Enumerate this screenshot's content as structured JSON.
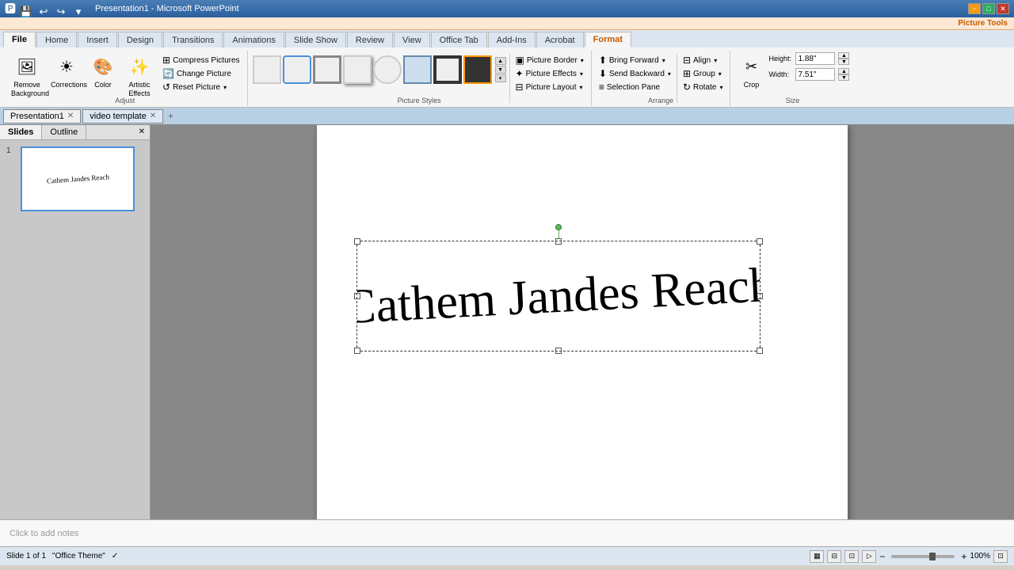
{
  "titleBar": {
    "title": "Presentation1 - Microsoft PowerPoint",
    "appIcon": "🅿",
    "controls": [
      "−",
      "□",
      "✕"
    ]
  },
  "contextualHeader": {
    "label": "Picture Tools"
  },
  "ribbonTabs": [
    {
      "id": "file",
      "label": "File"
    },
    {
      "id": "home",
      "label": "Home"
    },
    {
      "id": "insert",
      "label": "Insert"
    },
    {
      "id": "design",
      "label": "Design"
    },
    {
      "id": "transitions",
      "label": "Transitions"
    },
    {
      "id": "animations",
      "label": "Animations"
    },
    {
      "id": "slideshow",
      "label": "Slide Show"
    },
    {
      "id": "review",
      "label": "Review"
    },
    {
      "id": "view",
      "label": "View"
    },
    {
      "id": "officetab",
      "label": "Office Tab"
    },
    {
      "id": "addins",
      "label": "Add-Ins"
    },
    {
      "id": "acrobat",
      "label": "Acrobat"
    },
    {
      "id": "format",
      "label": "Format",
      "contextual": true,
      "active": true
    }
  ],
  "adjust": {
    "label": "Adjust",
    "removeBackground": "Remove\nBackground",
    "corrections": "Corrections",
    "color": "Color",
    "artisticEffects": "Artistic\nEffects",
    "compressPictures": "Compress Pictures",
    "changePicture": "Change Picture",
    "resetPicture": "Reset Picture"
  },
  "pictureStyles": {
    "label": "Picture Styles",
    "styles": [
      "s1",
      "s2",
      "s3",
      "s4",
      "s5",
      "s6",
      "s7",
      "s8"
    ],
    "pictureBorder": "Picture Border",
    "pictureEffects": "Picture Effects",
    "pictureLayout": "Picture Layout"
  },
  "arrange": {
    "label": "Arrange",
    "bringForward": "Bring Forward",
    "sendBackward": "Send Backward",
    "selectionPane": "Selection Pane",
    "align": "Align",
    "group": "Group",
    "rotate": "Rotate"
  },
  "size": {
    "label": "Size",
    "cropLabel": "Crop",
    "height": "1.88\"",
    "width": "7.51\"",
    "heightLabel": "Height:",
    "widthLabel": "Width:"
  },
  "docTabs": [
    {
      "label": "Presentation1",
      "active": true
    },
    {
      "label": "video template",
      "active": false
    }
  ],
  "slidePanel": {
    "tabs": [
      "Slides",
      "Outline"
    ],
    "activeTab": "Slides",
    "slideCount": 1
  },
  "canvas": {
    "selectedImageText": "Cathem Jandes Reach",
    "notesPlaceholder": "Click to add notes"
  },
  "statusBar": {
    "slideInfo": "Slide 1 of 1",
    "theme": "\"Office Theme\"",
    "checkmark": "✓",
    "zoom": "100%",
    "zoomPercent": 100
  }
}
